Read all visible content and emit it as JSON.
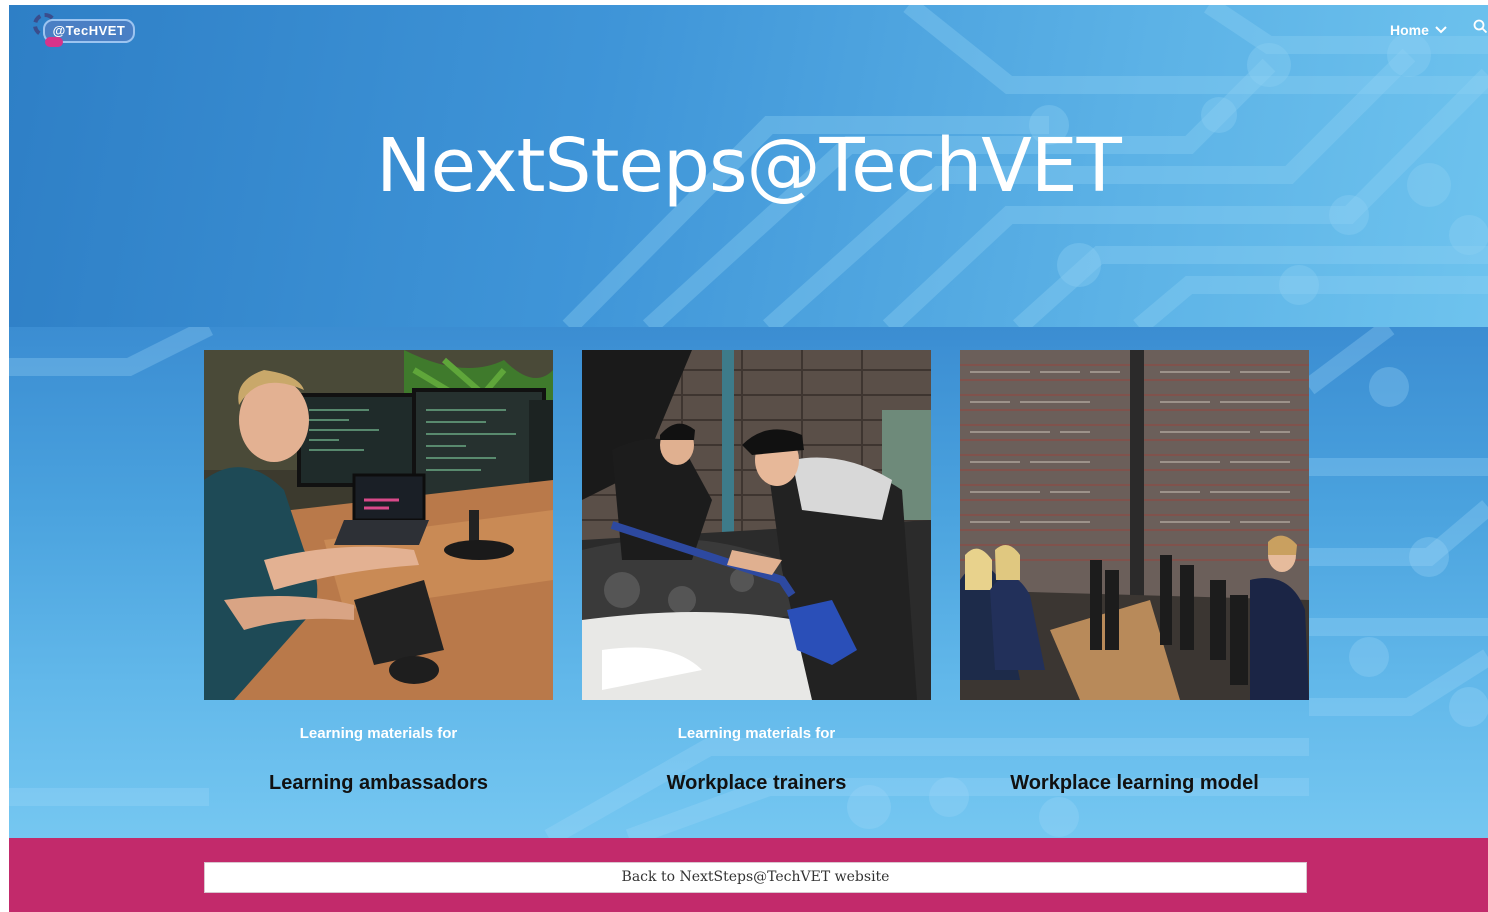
{
  "header": {
    "logo_text": "@TecHVET",
    "nav_home_label": "Home",
    "icons": [
      "chevron-down-icon",
      "search-icon"
    ]
  },
  "hero": {
    "title": "NextSteps@TechVET"
  },
  "cards": [
    {
      "subtitle": "Learning materials for",
      "title": "Learning ambassadors",
      "image": "developer at multi-monitor desk"
    },
    {
      "subtitle": "Learning materials for",
      "title": "Workplace trainers",
      "image": "mechanics working under car hood"
    },
    {
      "subtitle": "",
      "title": "Workplace learning model",
      "image": "students at computers in classroom"
    }
  ],
  "footer": {
    "back_label": "Back to NextSteps@TechVET website"
  },
  "colors": {
    "hero_blue": "#3f95d8",
    "footer_magenta": "#c22a6b",
    "text_white": "#ffffff",
    "card_title": "#111111"
  }
}
